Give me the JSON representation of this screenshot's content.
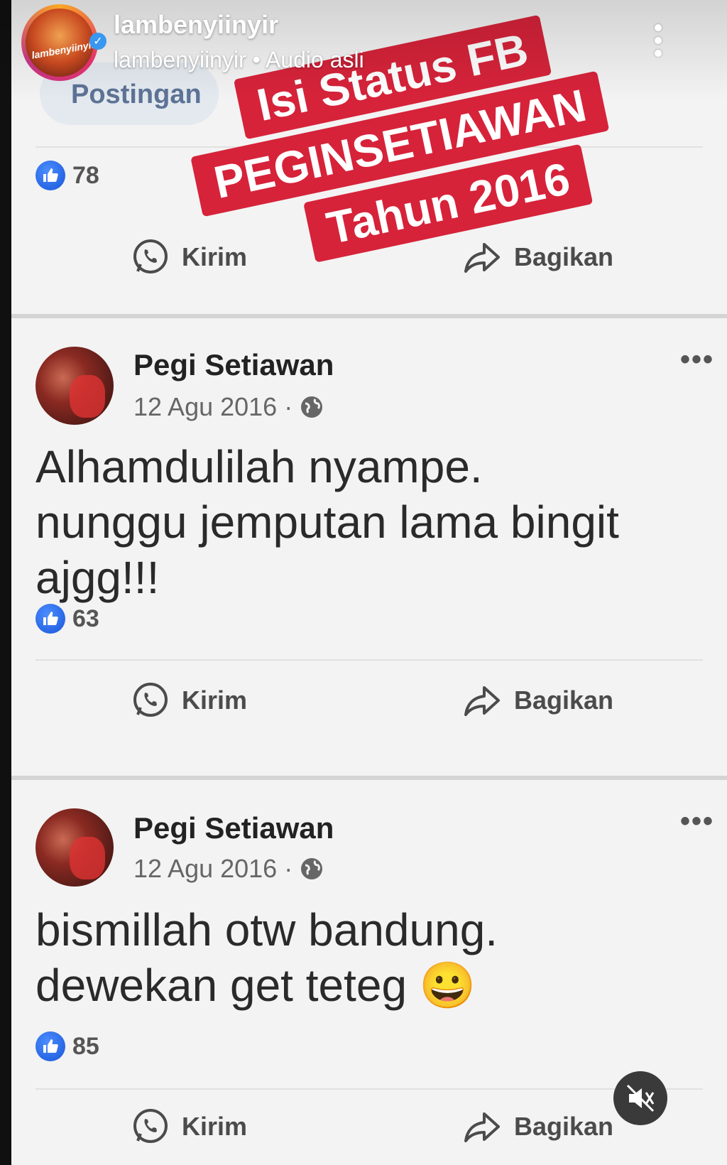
{
  "instagram": {
    "username": "lambenyiinyir",
    "subtitle": "lambenyiinyir • Audio asli",
    "avatar_text": "lambenyiinyir"
  },
  "overlay_banner": {
    "line1": "Isi Status FB",
    "line2": "PEGINSETIAWAN",
    "line3": "Tahun 2016"
  },
  "top_post": {
    "tab_label": "Postingan",
    "likes": "78",
    "send_label": "Kirim",
    "share_label": "Bagikan"
  },
  "posts": [
    {
      "author": "Pegi Setiawan",
      "date": "12 Agu 2016 ·",
      "text_lines": [
        "Alhamdulilah nyampe.",
        "nunggu jemputan lama bingit",
        "ajgg!!!"
      ],
      "likes": "63",
      "send_label": "Kirim",
      "share_label": "Bagikan",
      "more": "•••"
    },
    {
      "author": "Pegi Setiawan",
      "date": "12 Agu 2016 ·",
      "text_lines": [
        "bismillah otw bandung.",
        "dewekan get teteg 😀"
      ],
      "likes": "85",
      "send_label": "Kirim",
      "share_label": "Bagikan",
      "more": "•••"
    }
  ],
  "colors": {
    "like_blue": "#1856d8",
    "banner_red": "#d6233a"
  },
  "icons": [
    "like-icon",
    "whatsapp-icon",
    "share-icon",
    "globe-icon",
    "more-icon",
    "kebab-icon",
    "mute-icon",
    "verified-icon"
  ]
}
